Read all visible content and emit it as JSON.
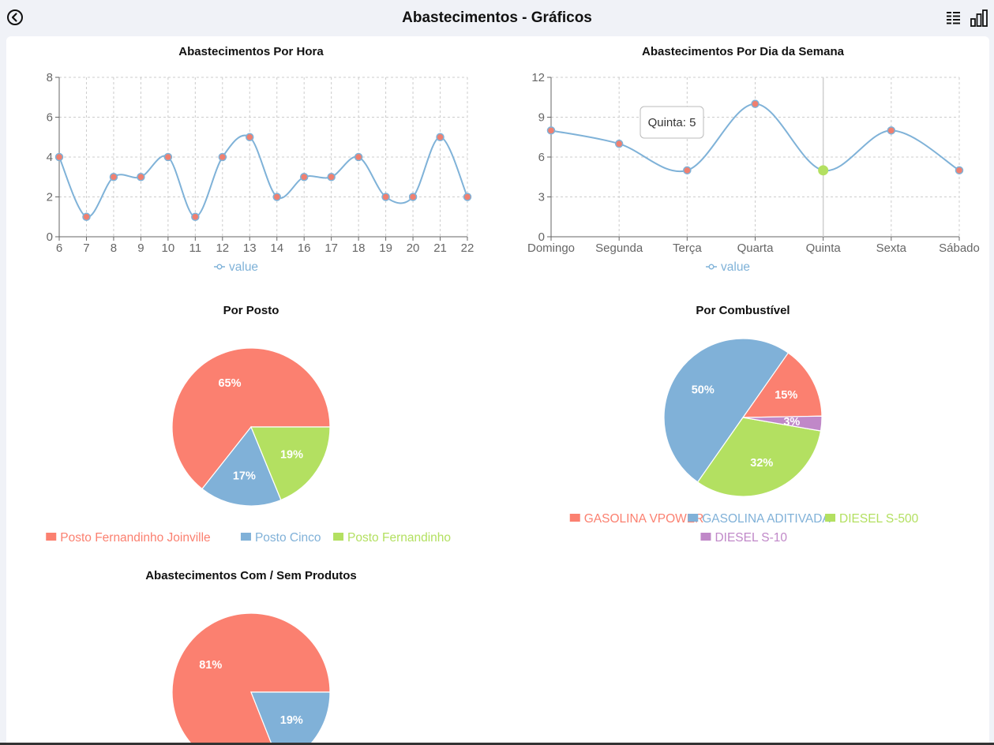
{
  "header": {
    "title": "Abastecimentos - Gráficos",
    "back_icon": "back-circle-icon",
    "list_icon": "list-view-icon",
    "chart_icon": "bar-chart-icon"
  },
  "colors": {
    "line": "#7fb2d8",
    "point": "#f08070",
    "active_point": "#b3e061",
    "grid": "#cccccc",
    "axis": "#666666"
  },
  "chart_data": [
    {
      "id": "hora",
      "type": "line",
      "title": "Abastecimentos Por Hora",
      "categories": [
        "6",
        "7",
        "8",
        "9",
        "10",
        "11",
        "12",
        "13",
        "14",
        "16",
        "17",
        "18",
        "19",
        "20",
        "21",
        "22"
      ],
      "series": [
        {
          "name": "value",
          "values": [
            4,
            1,
            3,
            3,
            4,
            1,
            4,
            5,
            2,
            3,
            3,
            4,
            2,
            2,
            5,
            2
          ]
        }
      ],
      "ylim": [
        0,
        8
      ],
      "yticks": [
        0,
        2,
        4,
        6,
        8
      ],
      "grid": true,
      "legend": "bottom"
    },
    {
      "id": "dia",
      "type": "line",
      "title": "Abastecimentos Por Dia da Semana",
      "categories": [
        "Domingo",
        "Segunda",
        "Terça",
        "Quarta",
        "Quinta",
        "Sexta",
        "Sábado"
      ],
      "series": [
        {
          "name": "value",
          "values": [
            8,
            7,
            5,
            10,
            5,
            8,
            5
          ]
        }
      ],
      "ylim": [
        0,
        12
      ],
      "yticks": [
        0,
        3,
        6,
        9,
        12
      ],
      "grid": true,
      "legend": "bottom",
      "tooltip": {
        "category": "Quinta",
        "text": "Quinta: 5"
      }
    },
    {
      "id": "posto",
      "type": "pie",
      "title": "Por Posto",
      "slices": [
        {
          "name": "Posto Fernandinho Joinville",
          "value": 65,
          "label": "65%",
          "color": "#fb8070"
        },
        {
          "name": "Posto Cinco",
          "value": 17,
          "label": "17%",
          "color": "#80b1d8"
        },
        {
          "name": "Posto Fernandinho",
          "value": 19,
          "label": "19%",
          "color": "#b3e061"
        }
      ],
      "legend": "bottom"
    },
    {
      "id": "combustivel",
      "type": "pie",
      "title": "Por Combustível",
      "slices": [
        {
          "name": "GASOLINA VPOWER",
          "value": 15,
          "label": "15%",
          "color": "#fb8070"
        },
        {
          "name": "GASOLINA ADITIVADA",
          "value": 50,
          "label": "50%",
          "color": "#80b1d8"
        },
        {
          "name": "DIESEL S-500",
          "value": 32,
          "label": "32%",
          "color": "#b3e061"
        },
        {
          "name": "DIESEL S-10",
          "value": 3,
          "label": "3%",
          "color": "#c088c8"
        }
      ],
      "legend": "bottom"
    },
    {
      "id": "produtos",
      "type": "pie",
      "title": "Abastecimentos Com / Sem Produtos",
      "slices": [
        {
          "name": "",
          "value": 81,
          "label": "81%",
          "color": "#fb8070"
        },
        {
          "name": "",
          "value": 19,
          "label": "19%",
          "color": "#80b1d8"
        }
      ],
      "legend": "none"
    }
  ]
}
